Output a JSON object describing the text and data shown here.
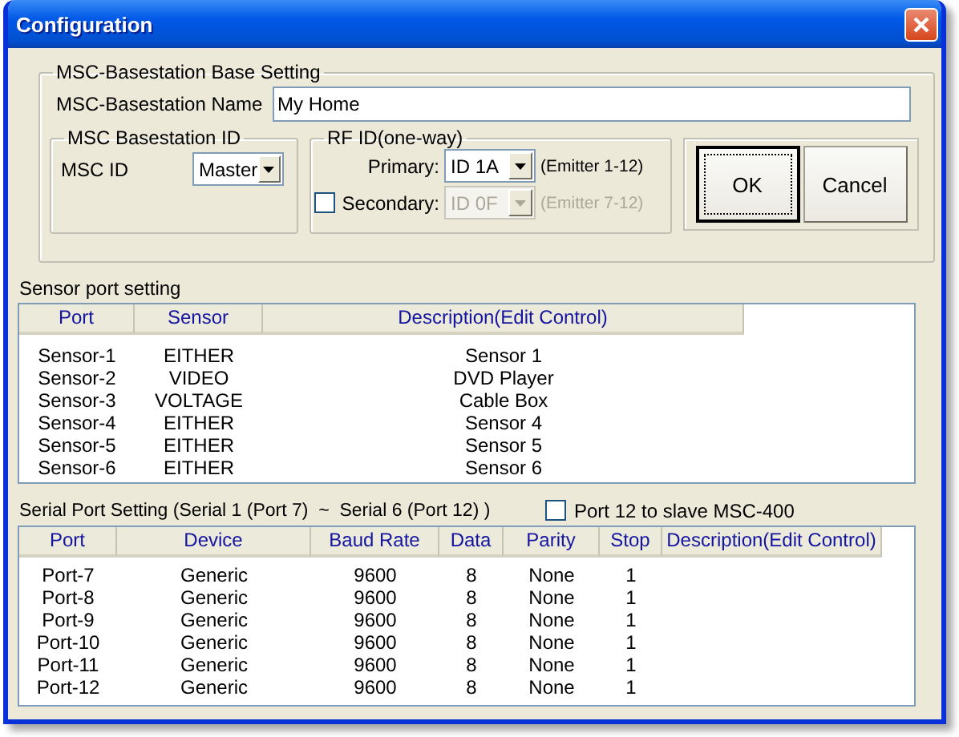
{
  "window": {
    "title": "Configuration"
  },
  "base_setting": {
    "title": "MSC-Basestation Base Setting",
    "name_label": "MSC-Basestation Name",
    "name_value": "My Home",
    "basestation_id": {
      "title": "MSC Basestation ID",
      "label": "MSC ID",
      "value": "Master"
    },
    "rf_id": {
      "title": "RF ID(one-way)",
      "rows": [
        {
          "kind": "plain",
          "label": "Primary:",
          "value": "ID 1A",
          "hint": "(Emitter 1-12)",
          "disabled": false
        },
        {
          "kind": "checkbox",
          "label": "Secondary:",
          "value": "ID 0F",
          "hint": "(Emitter 7-12)",
          "checked": false,
          "disabled": true
        }
      ]
    },
    "buttons": [
      {
        "label": "OK",
        "default": true
      },
      {
        "label": "Cancel",
        "default": false
      }
    ]
  },
  "sensor_ports": {
    "title": "Sensor port setting",
    "columns": [
      "Port",
      "Sensor",
      "Description(Edit Control)"
    ],
    "rows": [
      [
        "Sensor-1",
        "EITHER",
        "Sensor 1"
      ],
      [
        "Sensor-2",
        "VIDEO",
        "DVD Player"
      ],
      [
        "Sensor-3",
        "VOLTAGE",
        "Cable Box"
      ],
      [
        "Sensor-4",
        "EITHER",
        "Sensor 4"
      ],
      [
        "Sensor-5",
        "EITHER",
        "Sensor 5"
      ],
      [
        "Sensor-6",
        "EITHER",
        "Sensor 6"
      ]
    ]
  },
  "serial_ports": {
    "title": "Serial Port Setting (Serial 1 (Port 7)  ~  Serial 6 (Port 12) )",
    "slave_option": {
      "label": "Port 12 to slave MSC-400",
      "checked": false
    },
    "columns": [
      "Port",
      "Device",
      "Baud Rate",
      "Data",
      "Parity",
      "Stop",
      "Description(Edit Control)"
    ],
    "rows": [
      [
        "Port-7",
        "Generic",
        "9600",
        "8",
        "None",
        "1"
      ],
      [
        "Port-8",
        "Generic",
        "9600",
        "8",
        "None",
        "1"
      ],
      [
        "Port-9",
        "Generic",
        "9600",
        "8",
        "None",
        "1"
      ],
      [
        "Port-10",
        "Generic",
        "9600",
        "8",
        "None",
        "1"
      ],
      [
        "Port-11",
        "Generic",
        "9600",
        "8",
        "None",
        "1"
      ],
      [
        "Port-12",
        "Generic",
        "9600",
        "8",
        "None",
        "1"
      ]
    ]
  }
}
